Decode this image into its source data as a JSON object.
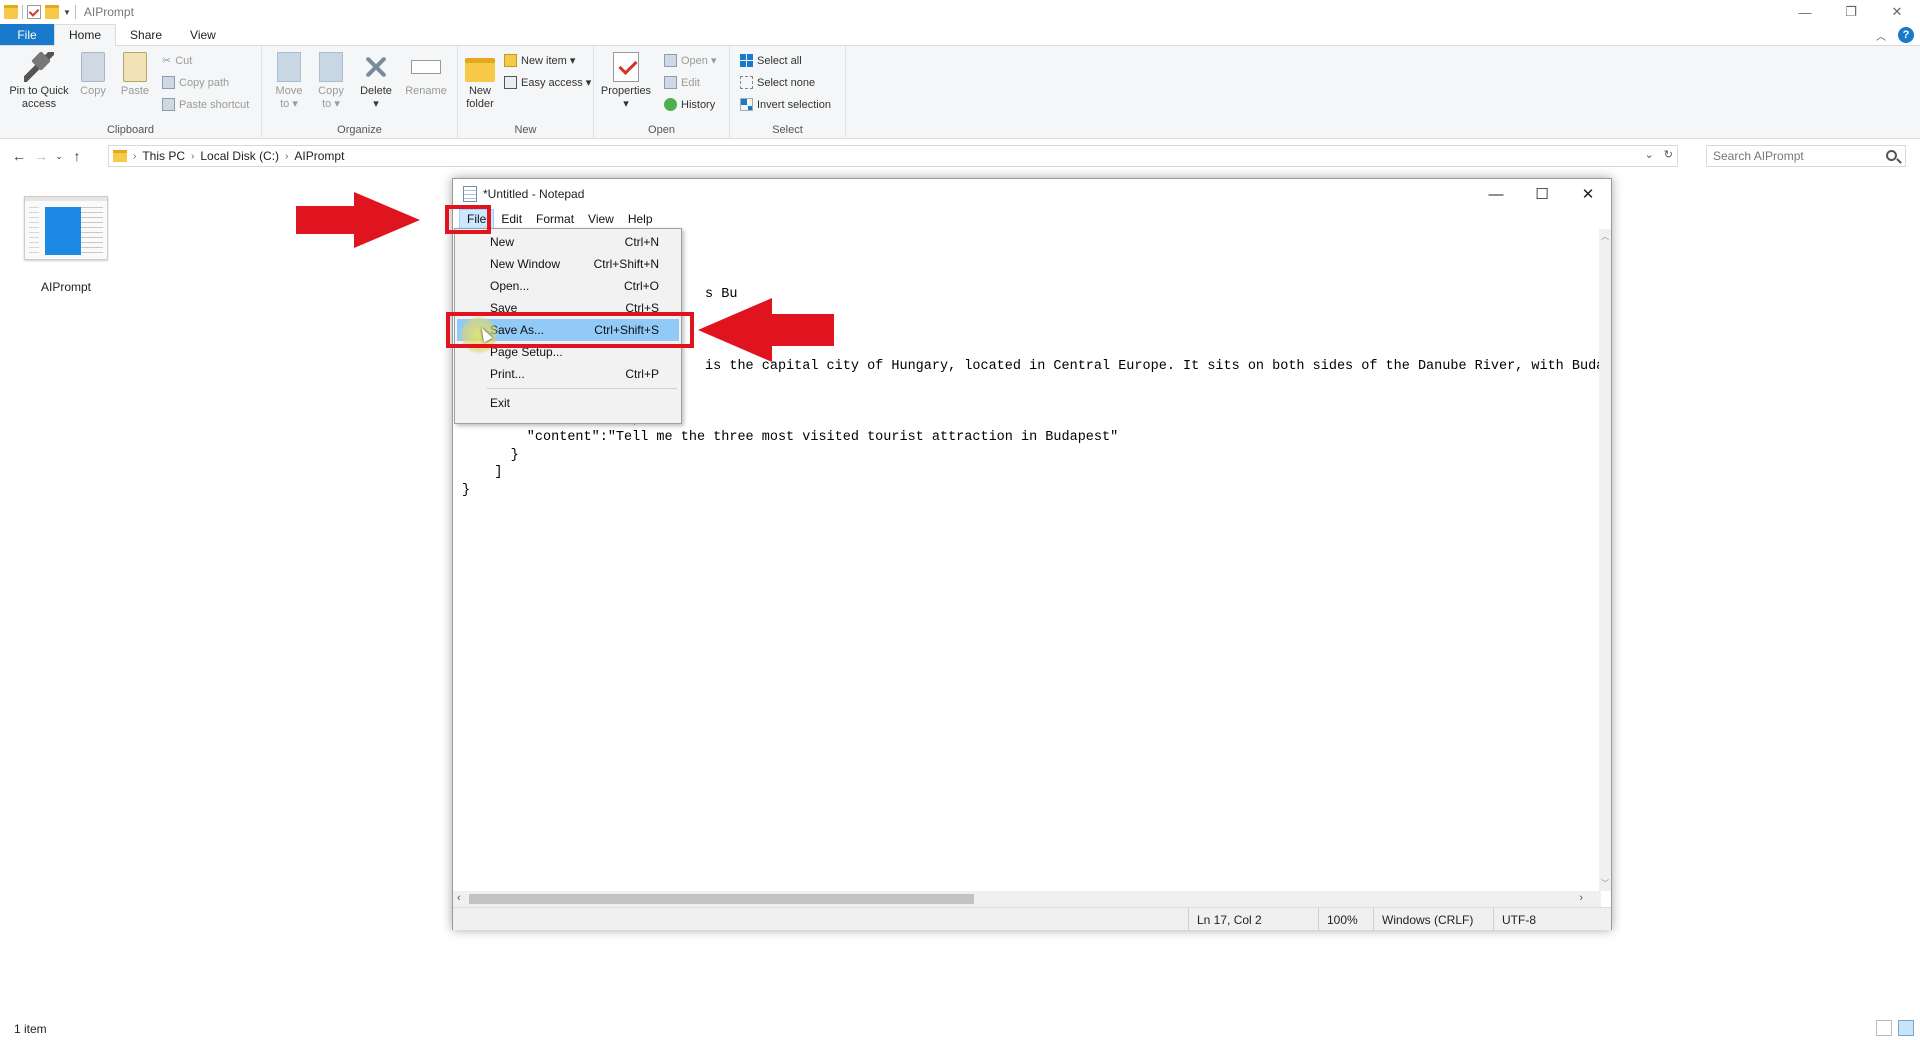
{
  "explorer": {
    "title": "AIPrompt",
    "win_controls": {
      "minimize": "—",
      "restore": "❐",
      "close": "✕"
    },
    "tabs": [
      "File",
      "Home",
      "Share",
      "View"
    ],
    "help": "?",
    "ribbon": {
      "clipboard": {
        "label": "Clipboard",
        "pin": "Pin to Quick\naccess",
        "copy": "Copy",
        "paste": "Paste",
        "cut": "Cut",
        "copy_path": "Copy path",
        "paste_shortcut": "Paste shortcut"
      },
      "organize": {
        "label": "Organize",
        "move_to": "Move\nto ▾",
        "copy_to": "Copy\nto ▾",
        "delete": "Delete\n▾",
        "rename": "Rename"
      },
      "new": {
        "label": "New",
        "new_folder": "New\nfolder",
        "new_item": "New item ▾",
        "easy_access": "Easy access ▾"
      },
      "open": {
        "label": "Open",
        "properties": "Properties\n▾",
        "open": "Open ▾",
        "edit": "Edit",
        "history": "History"
      },
      "select": {
        "label": "Select",
        "select_all": "Select all",
        "select_none": "Select none",
        "invert": "Invert selection"
      }
    },
    "address": {
      "crumbs": [
        "This PC",
        "Local Disk (C:)",
        "AIPrompt"
      ],
      "search_placeholder": "Search AIPrompt"
    },
    "file_item": "AIPrompt",
    "status": "1 item"
  },
  "notepad": {
    "title": "*Untitled - Notepad",
    "menus": [
      "File",
      "Edit",
      "Format",
      "View",
      "Help"
    ],
    "controls": {
      "minimize": "—",
      "maximize": "☐",
      "close": "✕"
    },
    "content_lines": [
      "",
      "",
      "",
      "                              s Bu",
      "",
      "",
      "",
      "                              is the capital city of Hungary, located in Central Europe. It sits on both sides of the Danube River, with Buda c",
      "      },",
      "      {",
      "        \"role\":\"user\",",
      "        \"content\":\"Tell me the three most visited tourist attraction in Budapest\"",
      "      }",
      "    ]",
      "}"
    ],
    "status": {
      "position": "Ln 17, Col 2",
      "zoom": "100%",
      "eol": "Windows (CRLF)",
      "encoding": "UTF-8"
    },
    "file_menu": [
      {
        "label": "New",
        "shortcut": "Ctrl+N"
      },
      {
        "label": "New Window",
        "shortcut": "Ctrl+Shift+N"
      },
      {
        "label": "Open...",
        "shortcut": "Ctrl+O"
      },
      {
        "label": "Save",
        "shortcut": "Ctrl+S"
      },
      {
        "label": "Save As...",
        "shortcut": "Ctrl+Shift+S"
      },
      {
        "label": "Page Setup...",
        "shortcut": ""
      },
      {
        "label": "Print...",
        "shortcut": "Ctrl+P"
      },
      {
        "label": "Exit",
        "shortcut": ""
      }
    ]
  },
  "colors": {
    "accent": "#1979ca",
    "annotation": "#e0141e",
    "menu_highlight": "#91c9f7"
  }
}
